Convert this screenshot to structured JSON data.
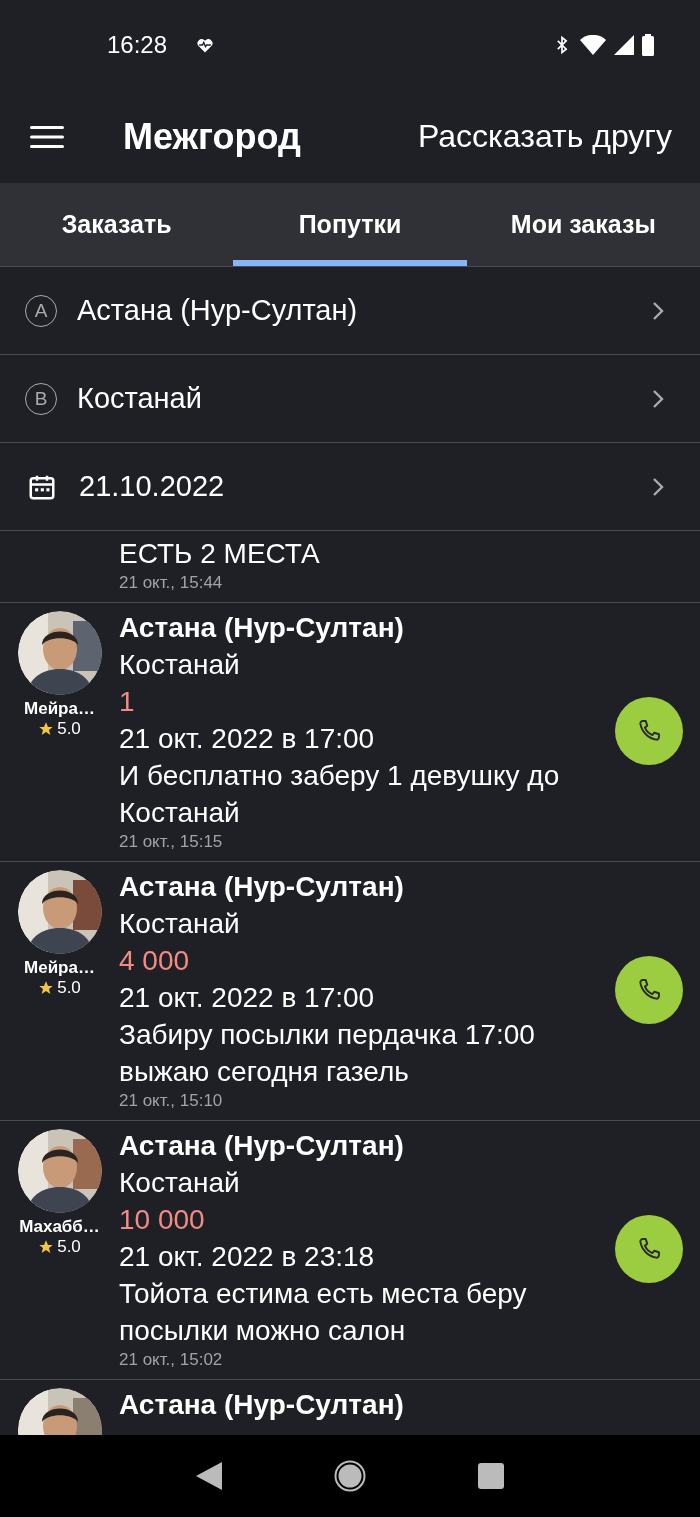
{
  "status_bar": {
    "time": "16:28"
  },
  "app_bar": {
    "title": "Межгород",
    "action": "Рассказать другу"
  },
  "tabs": [
    {
      "label": "Заказать",
      "selected": false
    },
    {
      "label": "Попутки",
      "selected": true
    },
    {
      "label": "Мои заказы",
      "selected": false
    }
  ],
  "filters": [
    {
      "kind": "point",
      "marker": "A",
      "value": "Астана (Нур-Султан)"
    },
    {
      "kind": "point",
      "marker": "B",
      "value": "Костанай"
    },
    {
      "kind": "date",
      "value": "21.10.2022"
    }
  ],
  "rides": [
    {
      "kind": "top_cut",
      "description": "ЕСТЬ 2 МЕСТА",
      "posted": "21 окт., 15:44"
    },
    {
      "kind": "full",
      "driver": "Мейра…",
      "rating": "5.0",
      "from": "Астана (Нур-Султан)",
      "to": "Костанай",
      "price": "1",
      "date": "21 окт. 2022 в 17:00",
      "description": "И бесплатно заберу 1 девушку до Костанай",
      "posted": "21 окт., 15:15"
    },
    {
      "kind": "full",
      "driver": "Мейра…",
      "rating": "5.0",
      "from": "Астана (Нур-Султан)",
      "to": "Костанай",
      "price": "4 000",
      "date": "21 окт. 2022 в 17:00",
      "description": "Забиру посылки пердачка 17:00 выжаю сегодня газель",
      "posted": "21 окт., 15:10"
    },
    {
      "kind": "full",
      "driver": "Махабб…",
      "rating": "5.0",
      "from": "Астана (Нур-Султан)",
      "to": "Костанай",
      "price": "10 000",
      "date": "21 окт. 2022 в 23:18",
      "description": "Тойота естима есть места беру посылки можно салон",
      "posted": "21 окт., 15:02"
    },
    {
      "kind": "bottom_cut",
      "from": "Астана (Нур-Султан)"
    }
  ]
}
